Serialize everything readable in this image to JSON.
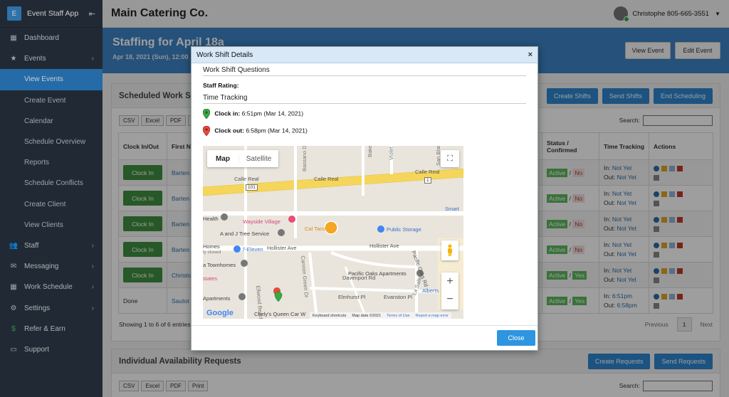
{
  "app": {
    "logo_letter": "E",
    "name": "Event Staff App"
  },
  "topbar": {
    "company": "Main Catering Co.",
    "user_label": "Christophe 805-665-3551"
  },
  "sidebar": {
    "items": [
      {
        "label": "Dashboard",
        "icon": "dashboard-icon"
      },
      {
        "label": "Events",
        "icon": "star-icon"
      },
      {
        "label": "View Events"
      },
      {
        "label": "Create Event"
      },
      {
        "label": "Calendar"
      },
      {
        "label": "Schedule Overview"
      },
      {
        "label": "Reports"
      },
      {
        "label": "Schedule Conflicts"
      },
      {
        "label": "Create Client"
      },
      {
        "label": "View Clients"
      },
      {
        "label": "Staff",
        "icon": "users-icon"
      },
      {
        "label": "Messaging",
        "icon": "envelope-icon"
      },
      {
        "label": "Work Schedule",
        "icon": "calendar-icon"
      },
      {
        "label": "Settings",
        "icon": "gear-icon"
      },
      {
        "label": "Refer & Earn",
        "icon": "dollar-icon"
      },
      {
        "label": "Support",
        "icon": "chat-icon"
      }
    ]
  },
  "banner": {
    "title": "Staffing for April 18a",
    "subtitle": "Apr 18, 2021 (Sun), 12:00",
    "view_event": "View Event",
    "edit_event": "Edit Event"
  },
  "scheduled": {
    "title": "Scheduled Work Sh",
    "create_shifts": "Create Shifts",
    "send_shifts": "Send Shifts",
    "end_scheduling": "End Scheduling",
    "tools": [
      "CSV",
      "Excel",
      "PDF",
      "Pri"
    ],
    "search_label": "Search:",
    "headers": {
      "clock": "Clock In/Out",
      "first": "First Name",
      "status": "Status / Confirmed",
      "time": "Time Tracking",
      "actions": "Actions"
    },
    "rows": [
      {
        "clock": "Clock In",
        "first": "Barten",
        "status": "Active",
        "conf": "No",
        "in": "Not Yet",
        "out": "Not Yet"
      },
      {
        "clock": "Clock In",
        "first": "Barten",
        "status": "Active",
        "conf": "No",
        "in": "Not Yet",
        "out": "Not Yet"
      },
      {
        "clock": "Clock In",
        "first": "Barten",
        "status": "Active",
        "conf": "No",
        "in": "Not Yet",
        "out": "Not Yet"
      },
      {
        "clock": "Clock In",
        "first": "Barten",
        "status": "Active",
        "conf": "No",
        "in": "Not Yet",
        "out": "Not Yet"
      },
      {
        "clock": "Clock In",
        "first": "Christo",
        "status": "Active",
        "conf": "Yes",
        "in": "Not Yet",
        "out": "Not Yet"
      },
      {
        "clock": "Done",
        "first": "Sautot",
        "status": "Active",
        "conf": "Yes",
        "in": "6:51pm",
        "out": "6:58pm"
      }
    ],
    "in_prefix": "In:",
    "out_prefix": "Out:",
    "showing": "Showing 1 to 6 of 6 entries",
    "previous": "Previous",
    "page": "1",
    "next": "Next"
  },
  "availability": {
    "title": "Individual Availability Requests",
    "create_requests": "Create Requests",
    "send_requests": "Send Requests",
    "tools": [
      "CSV",
      "Excel",
      "PDF",
      "Print"
    ],
    "search_label": "Search:"
  },
  "modal": {
    "title": "Work Shift Details",
    "close_x": "×",
    "questions_title": "Work Shift Questions",
    "rating_label": "Staff Rating:",
    "tracking_title": "Time Tracking",
    "clock_in_label": "Clock in:",
    "clock_in_value": "6:51pm (Mar 14, 2021)",
    "clock_out_label": "Clock out:",
    "clock_out_value": "6:58pm (Mar 14, 2021)",
    "close_button": "Close",
    "map": {
      "tab_map": "Map",
      "tab_satellite": "Satellite",
      "zoom_in": "+",
      "zoom_out": "−",
      "streets": [
        "Calle Real",
        "Calle Real",
        "Calle Real",
        "Hollister Ave",
        "Hollister Ave",
        "Davenport Rd",
        "Elmhurst Pl",
        "Evanston Pl",
        "Pacific Oaks Rd",
        "Baker Ln",
        "Violet Ln",
        "Bassano Dr",
        "Cannon Green Dr",
        "Ellwood Beach Dr",
        "San Blanco Dr",
        "La Salle"
      ],
      "places": [
        "Wayside Village",
        "A and J Tree Service",
        "Cal Taco",
        "Public Storage",
        "7-Eleven",
        "Pacific Oaks Apartments",
        "Health",
        "Homes",
        "ly closed",
        "a Townhomes",
        "states",
        "Apartments",
        "Chely's Queen Car W",
        "Smart",
        "Alberts"
      ],
      "route_number": "101",
      "route_number_2": "1",
      "google": "Google",
      "footer_shortcuts": "Keyboard shortcuts",
      "footer_data": "Map data ©2021",
      "footer_terms": "Terms of Use",
      "footer_report": "Report a map error"
    }
  },
  "colors": {
    "sidebar": "#2a3542",
    "accent": "#2e86d1",
    "banner": "#3d84c6",
    "green": "#3f8f3f"
  }
}
